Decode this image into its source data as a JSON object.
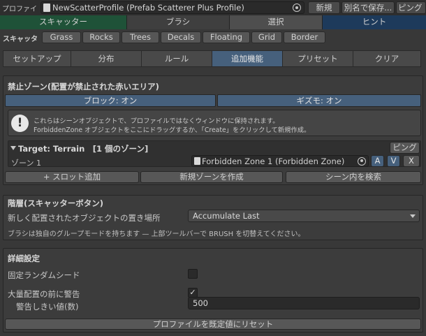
{
  "profile": {
    "label": "プロファイ",
    "name": "NewScatterProfile (Prefab Scatterer Plus Profile)",
    "new_label": "新規",
    "save_as_label": "別名で保存...",
    "ping_label": "ピング"
  },
  "main_tabs": [
    {
      "label": "スキャッター",
      "color": "#1f5238"
    },
    {
      "label": "ブラシ",
      "color": "#3f3f3f"
    },
    {
      "label": "選択",
      "color": "#4e4e4e"
    },
    {
      "label": "ヒント",
      "color": "#1d3a5b"
    }
  ],
  "category": {
    "label": "スキャッタ",
    "items": [
      "Grass",
      "Rocks",
      "Trees",
      "Decals",
      "Floating",
      "Grid",
      "Border"
    ]
  },
  "sub_tabs": [
    "セットアップ",
    "分布",
    "ルール",
    "追加機能",
    "プリセット",
    "クリア"
  ],
  "active_sub_tab": 3,
  "forbidden": {
    "title": "禁止ゾーン(配置が禁止された赤いエリア)",
    "block_label": "ブロック: オン",
    "gizmo_label": "ギズモ: オン",
    "help_line1": "これらはシーンオブジェクトで、プロファイルではなくウィンドウに保持されます。",
    "help_line2": "ForbiddenZone オブジェクトをここにドラッグするか、「Create」をクリックして新規作成。",
    "target_header": "Target: Terrain　[1 個のゾーン]",
    "ping_label": "ピング",
    "zone_label": "ゾーン 1",
    "zone_object": "Forbidden Zone 1 (Forbidden Zone)",
    "btn_a": "A",
    "btn_v": "V",
    "btn_x": "X",
    "add_slot_label": "+ スロット追加",
    "new_zone_label": "新規ゾーンを作成",
    "search_scene_label": "シーン内を検索"
  },
  "hierarchy": {
    "title": "階層(スキャッターボタン)",
    "placement_label": "新しく配置されたオブジェクトの置き場所",
    "placement_value": "Accumulate Last",
    "hint": "ブラシは独自のグループモードを持ちます — 上部ツールバーで BRUSH を切替えてください。"
  },
  "advanced": {
    "title": "詳細設定",
    "fixed_seed_label": "固定ランダムシード",
    "fixed_seed_checked": false,
    "warn_label": "大量配置の前に警告",
    "warn_checked": true,
    "threshold_label": "警告しきい値(数)",
    "threshold_value": "500",
    "reset_label": "プロファイルを既定値にリセット"
  }
}
